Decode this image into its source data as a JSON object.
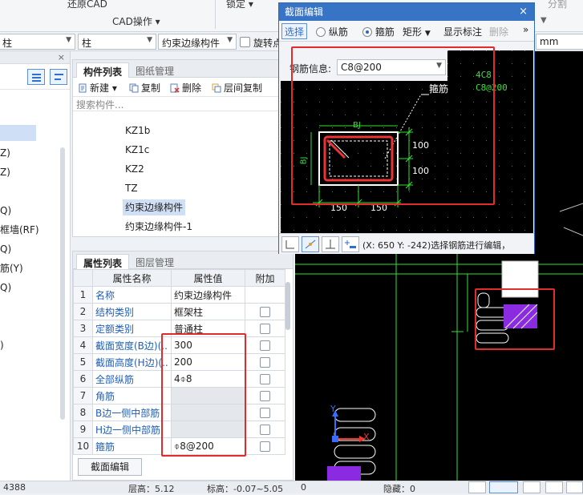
{
  "ribbon": {
    "restore_cad": "还原CAD",
    "cad_ops": "CAD操作 ▾",
    "lock": "锁定 ▾",
    "right_label": "分割"
  },
  "toolbar2": {
    "combo1": "柱",
    "combo2": "柱",
    "combo3": "约束边缘构件",
    "rotate_point": "旋转点",
    "input_right": "mm"
  },
  "left_tree": {
    "items": [
      "Z)",
      "Z)",
      "Q)",
      "框墙(RF)",
      "Q)",
      "筋(Y)",
      "Q)",
      ")"
    ]
  },
  "component_list": {
    "tabs": [
      "构件列表",
      "图纸管理"
    ],
    "tools": {
      "new": "新建",
      "copy": "复制",
      "delete": "删除",
      "floor_copy": "层间复制"
    },
    "search_placeholder": "搜索构件...",
    "items": [
      "KZ1b",
      "KZ1c",
      "KZ2",
      "TZ",
      "约束边缘构件",
      "约束边缘构件-1"
    ]
  },
  "properties": {
    "tabs": [
      "属性列表",
      "图层管理"
    ],
    "headers": [
      "属性名称",
      "属性值",
      "附加"
    ],
    "rows": [
      {
        "idx": "1",
        "name": "名称",
        "value": "约束边缘构件"
      },
      {
        "idx": "2",
        "name": "结构类别",
        "value": "框架柱"
      },
      {
        "idx": "3",
        "name": "定额类别",
        "value": "普通柱"
      },
      {
        "idx": "4",
        "name": "截面宽度(B边)(...",
        "value": "300"
      },
      {
        "idx": "5",
        "name": "截面高度(H边)(...",
        "value": "200"
      },
      {
        "idx": "6",
        "name": "全部纵筋",
        "value": "4⌽8"
      },
      {
        "idx": "7",
        "name": "角筋",
        "value": ""
      },
      {
        "idx": "8",
        "name": "B边一侧中部筋",
        "value": ""
      },
      {
        "idx": "9",
        "name": "H边一侧中部筋",
        "value": ""
      },
      {
        "idx": "10",
        "name": "箍筋",
        "value": "⌽8@200"
      }
    ],
    "section_edit_button": "截面编辑"
  },
  "dialog": {
    "title": "截面编辑",
    "close": "×",
    "tools": {
      "select": "选择",
      "longitudinal": "纵筋",
      "stirrup": "箍筋",
      "shape": "矩形",
      "show_label": "显示标注",
      "delete": "删除",
      "more": "»"
    },
    "rebar_info_label": "钢筋信息:",
    "rebar_info_value": "C8@200",
    "canvas": {
      "leader_label": "箍筋",
      "note_line1": "4C8",
      "note_line2": "C8@200",
      "label_top": "BJ",
      "label_left": "BJ",
      "dim_r1": "100",
      "dim_r2": "100",
      "dim_b1": "150",
      "dim_b2": "150"
    },
    "status_text": "(X: 650 Y: -242)选择钢筋进行编辑，"
  },
  "cad": {
    "axis_y": "Y",
    "axis_x": "X"
  },
  "statusbar": {
    "left": "4388",
    "floor_height": "层高：5.12",
    "elevation": "标高：-0.07~5.05",
    "zero": "0",
    "hidden": "隐藏：0"
  },
  "colors": {
    "accent": "#3874c6",
    "annotation_red": "#e32b2b",
    "cad_green": "#35e035",
    "cad_purple": "#8a2be2"
  }
}
